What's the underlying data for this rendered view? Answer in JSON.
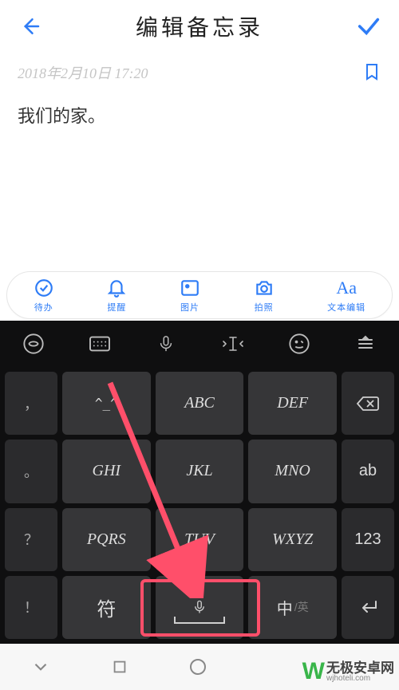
{
  "colors": {
    "accent": "#2e7cf6",
    "highlight": "#ff4f6a",
    "wm_green": "#39b54a"
  },
  "header": {
    "title": "编辑备忘录"
  },
  "note": {
    "timestamp": "2018年2月10日  17:20",
    "body": "我们的家。"
  },
  "toolbar": {
    "items": [
      {
        "icon": "check-circle-icon",
        "label": "待办"
      },
      {
        "icon": "bell-icon",
        "label": "提醒"
      },
      {
        "icon": "image-icon",
        "label": "图片"
      },
      {
        "icon": "camera-icon",
        "label": "拍照"
      },
      {
        "icon": "text-aa-icon",
        "label": "文本编辑"
      }
    ]
  },
  "keyboard": {
    "top_icons": [
      "ime-logo-icon",
      "keyboard-icon",
      "mic-icon",
      "cursor-icon",
      "smiley-icon",
      "menu-bars-icon"
    ],
    "rows": [
      {
        "punc": "，",
        "k1": "^_^",
        "k2": "ABC",
        "k3": "DEF",
        "side": "backspace"
      },
      {
        "punc": "。",
        "k1": "GHI",
        "k2": "JKL",
        "k3": "MNO",
        "side": "ab"
      },
      {
        "punc": "？",
        "k1": "PQRS",
        "k2": "TUV",
        "k3": "WXYZ",
        "side": "123"
      },
      {
        "punc": "！",
        "k1": "符",
        "k2_icon": "mic-small-icon",
        "k3_main": "中",
        "k3_sec": "/英",
        "side": "enter"
      }
    ]
  },
  "watermark": {
    "logo": "W",
    "cn": "无极安卓网",
    "en": "wjhoteli.com"
  }
}
